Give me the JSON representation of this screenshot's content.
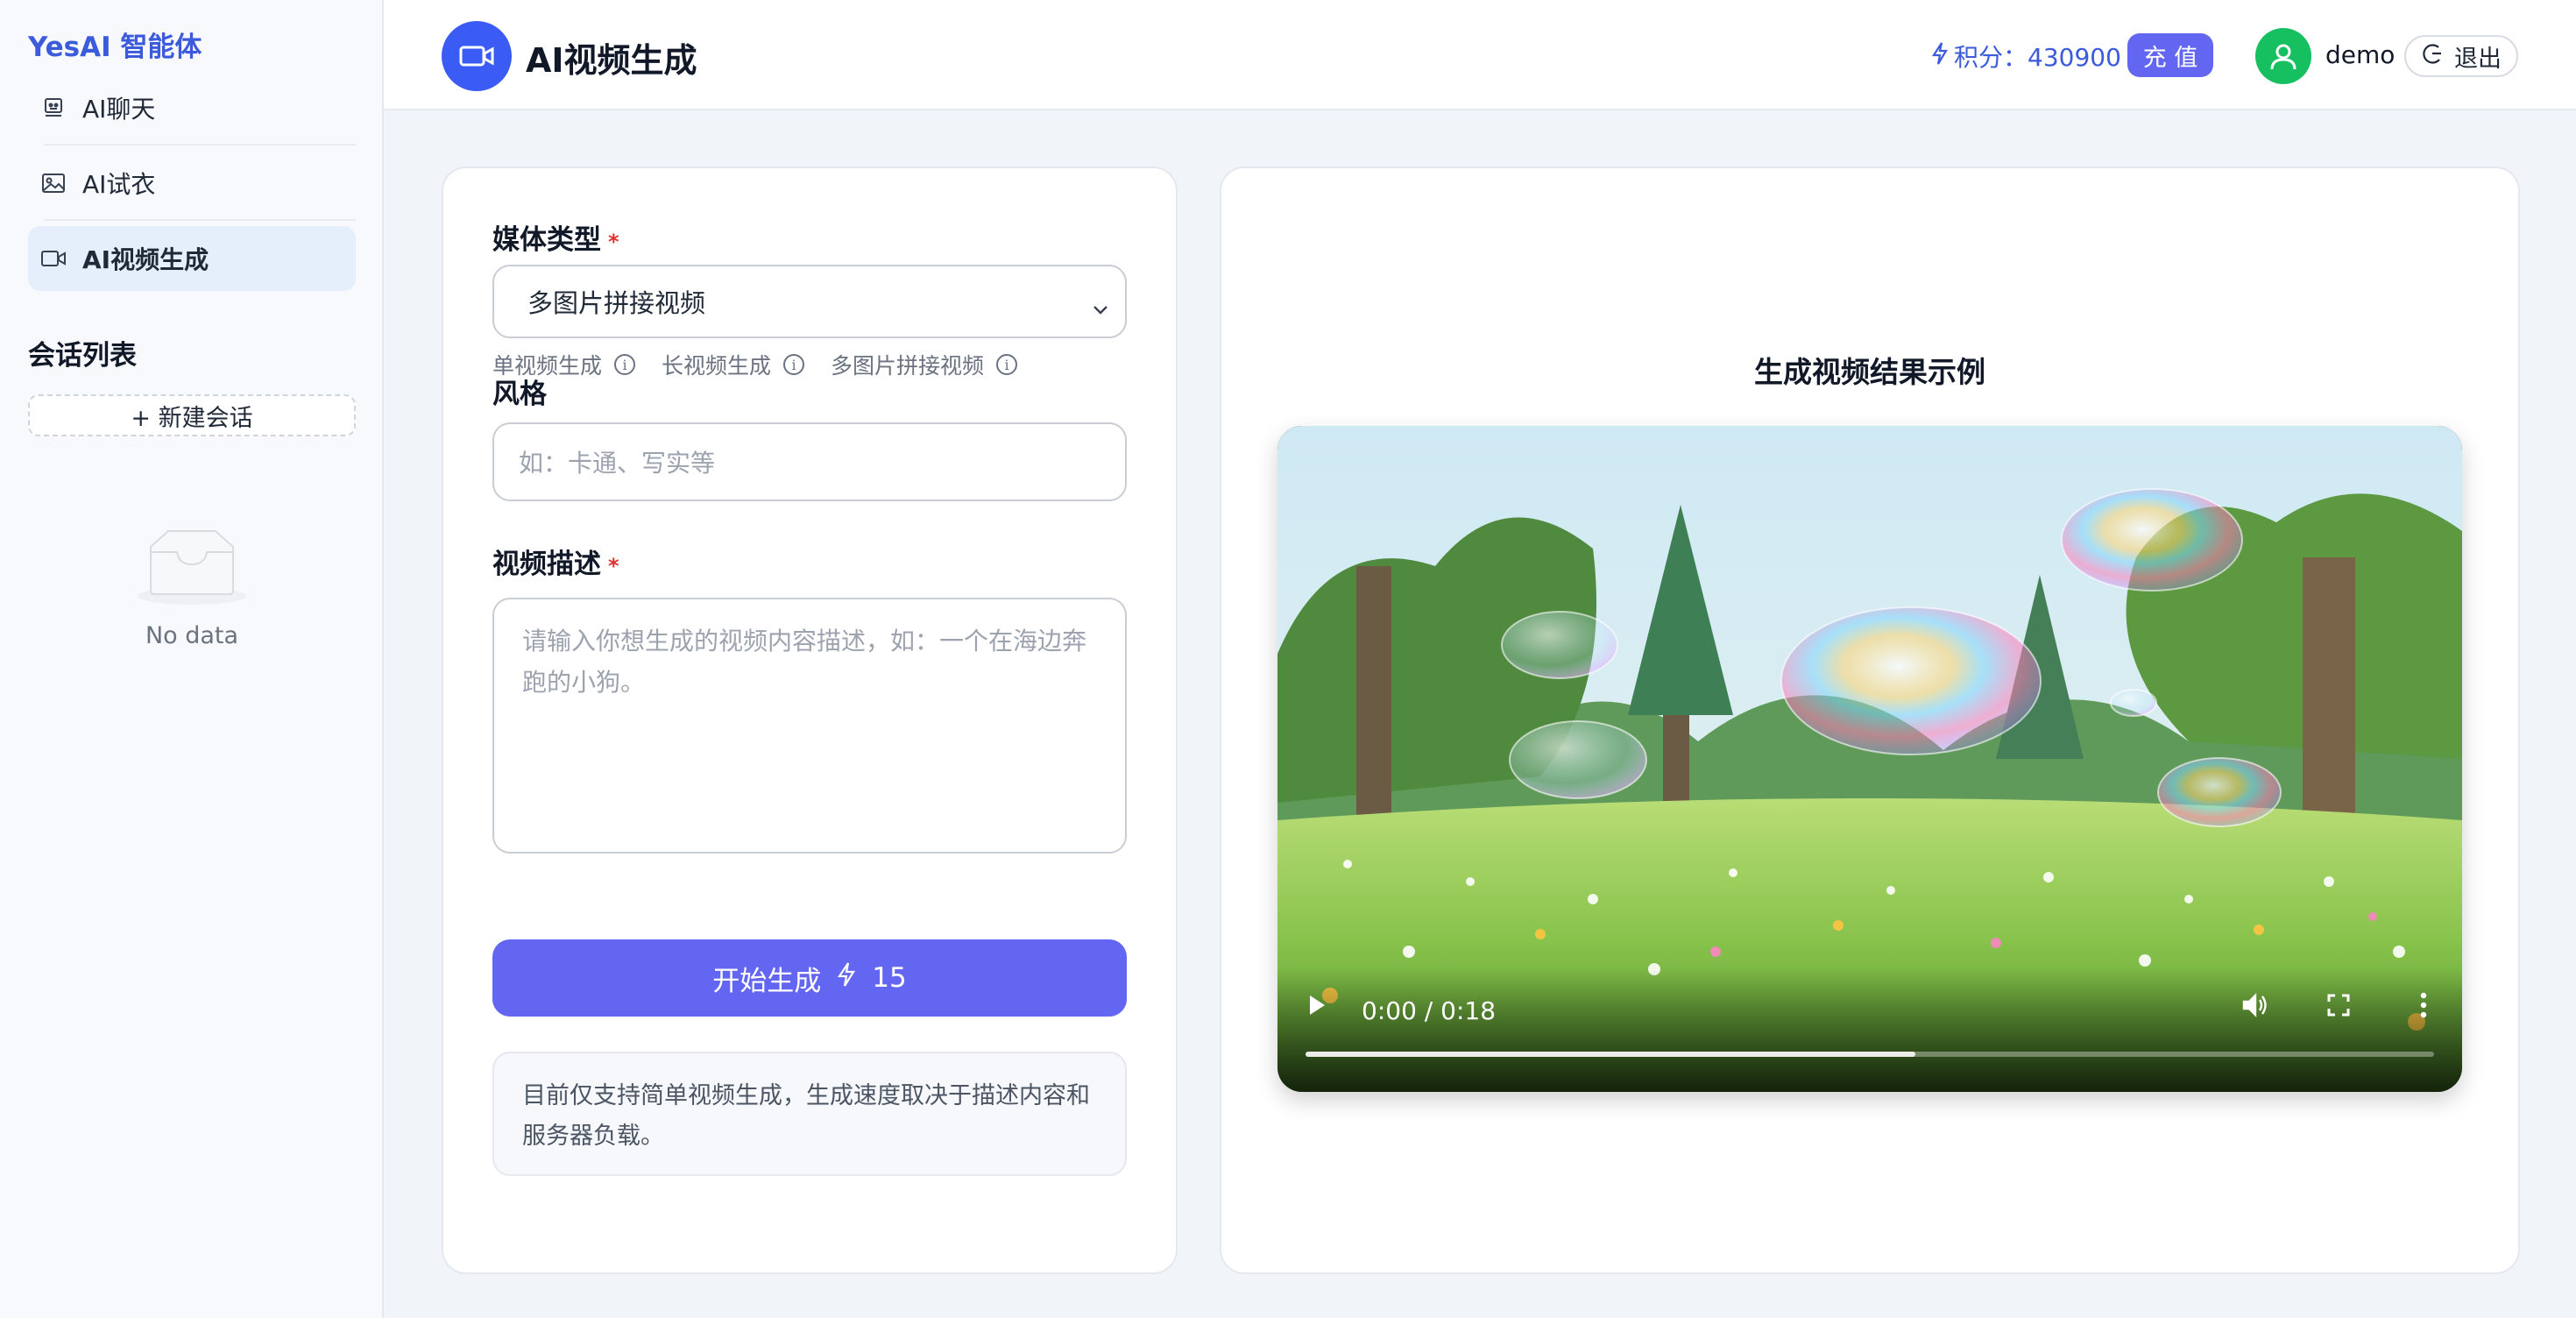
{
  "sidebar": {
    "brand": "YesAI 智能体",
    "items": [
      {
        "label": "AI聊天",
        "icon": "bot-icon"
      },
      {
        "label": "AI试衣",
        "icon": "image-icon"
      },
      {
        "label": "AI视频生成",
        "icon": "video-icon",
        "active": true
      }
    ],
    "section_title": "会话列表",
    "new_chat_label": "+ 新建会话",
    "empty_text": "No data"
  },
  "header": {
    "title": "AI视频生成",
    "points_label": "积分：430900",
    "recharge_label": "充 值",
    "username": "demo",
    "logout_label": "退出"
  },
  "form": {
    "media_type_label": "媒体类型",
    "media_type_value": "多图片拼接视频",
    "hints": [
      "单视频生成",
      "长视频生成",
      "多图片拼接视频"
    ],
    "style_label": "风格",
    "style_placeholder": "如：卡通、写实等",
    "description_label": "视频描述",
    "description_placeholder": "请输入你想生成的视频内容描述，如：一个在海边奔跑的小狗。",
    "generate_label": "开始生成",
    "generate_cost": "15",
    "note": "目前仅支持简单视频生成，生成速度取决于描述内容和服务器负载。"
  },
  "result": {
    "title": "生成视频结果示例",
    "video": {
      "current_time": "0:00",
      "separator": "/",
      "duration": "0:18",
      "buffered_fraction": 0.54
    }
  },
  "colors": {
    "accent": "#6366f1",
    "brand_blue": "#3b5bdb",
    "avatar_green": "#16c060",
    "required_red": "#e03131"
  }
}
